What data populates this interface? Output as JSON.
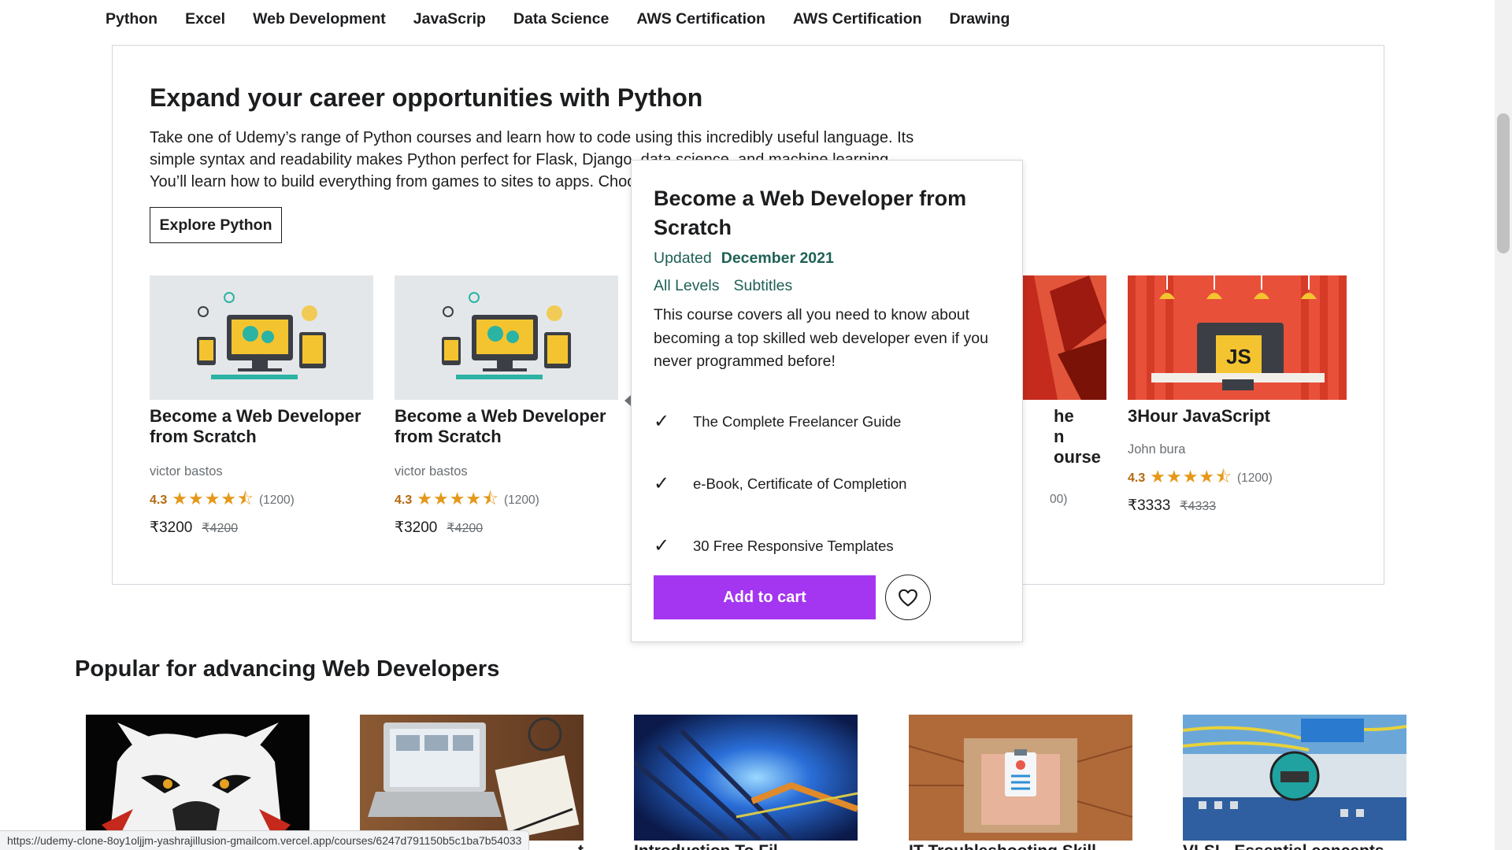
{
  "category_nav": [
    "Python",
    "Excel",
    "Web Development",
    "JavaScrip",
    "Data Science",
    "AWS Certification",
    "AWS Certification",
    "Drawing"
  ],
  "featured": {
    "title": "Expand your career opportunities with Python",
    "description": "Take one of Udemy’s range of Python courses and learn how to code using this incredibly useful language. Its simple syntax and readability makes Python perfect for Flask, Django, data science, and machine learning. You’ll learn how to build everything from games to sites to apps. Choose fro",
    "explore_button": "Explore Python",
    "courses": [
      {
        "title": "Become a Web Developer from Scratch",
        "author": "victor bastos",
        "rating": "4.3",
        "reviews": "(1200)",
        "price": "₹3200",
        "old_price": "₹4200",
        "stars": "★★★★⯪"
      },
      {
        "title": "Become a Web Developer from Scratch",
        "author": "victor bastos",
        "rating": "4.3",
        "reviews": "(1200)",
        "price": "₹3200",
        "old_price": "₹4200",
        "stars": "★★★★⯪"
      },
      {
        "title_fragment_1": "he",
        "title_fragment_2": "n",
        "title_fragment_3": "ourse",
        "reviews_fragment": "00)"
      },
      {
        "title": "3Hour JavaScript",
        "author": "John bura",
        "rating": "4.3",
        "reviews": "(1200)",
        "price": "₹3333",
        "old_price": "₹4333",
        "stars": "★★★★⯪"
      }
    ]
  },
  "popover": {
    "title": "Become a Web Developer from Scratch",
    "updated_label": "Updated",
    "updated_date": "December 2021",
    "level": "All Levels",
    "subtitles": "Subtitles",
    "description": "This course covers all you need to know about becoming a top skilled web developer even if you never programmed before!",
    "features": [
      "The Complete Freelancer Guide",
      "e-Book, Certificate of Completion",
      "30 Free Responsive Templates"
    ],
    "add_to_cart": "Add to cart",
    "wishlist_icon": "heart-icon"
  },
  "popular": {
    "title": "Popular for advancing Web Developers",
    "captions": [
      "",
      "t",
      "Introduction To Fil",
      "IT Troubleshooting Skill",
      "VLSI - Essential concepts"
    ]
  },
  "status_url": "https://udemy-clone-8oy1oljjm-yashrajillusion-gmailcom.vercel.app/courses/6247d791150b5c1ba7b54033",
  "colors": {
    "accent": "#a435f0",
    "rating": "#b4690e",
    "star": "#e59819",
    "teal": "#1e6055"
  }
}
